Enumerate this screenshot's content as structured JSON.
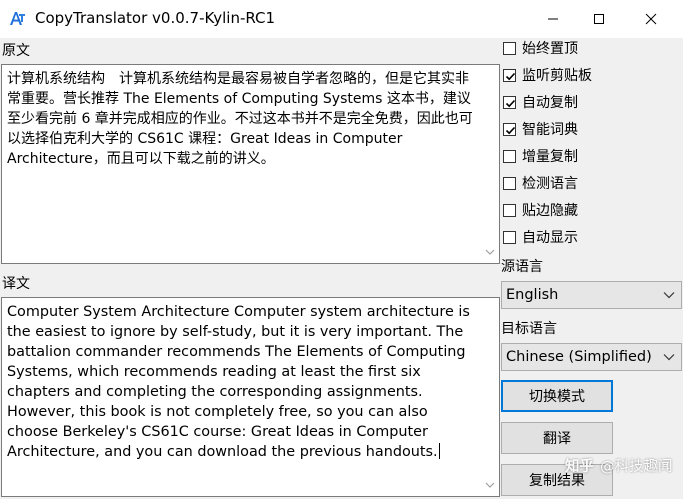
{
  "window": {
    "title": "CopyTranslator v0.0.7-Kylin-RC1",
    "icon": "copytranslator-logo-icon",
    "controls": [
      "minimize-icon",
      "maximize-icon",
      "close-icon"
    ]
  },
  "source": {
    "label": "原文",
    "text": "计算机系统结构　计算机系统结构是最容易被自学者忽略的，但是它其实非常重要。营长推荐 The Elements of Computing Systems 这本书，建议至少看完前 6 章并完成相应的作业。不过这本书并不是完全免费，因此也可以选择伯克利大学的 CS61C 课程：Great Ideas in Computer Architecture，而且可以下载之前的讲义。"
  },
  "target": {
    "label": "译文",
    "text": "Computer System Architecture Computer system architecture is the easiest to ignore by self-study, but it is very important. The battalion commander recommends The Elements of Computing Systems, which recommends reading at least the first six chapters and completing the corresponding assignments. However, this book is not completely free, so you can also choose Berkeley's CS61C course: Great Ideas in Computer Architecture, and you can download the previous handouts."
  },
  "options": [
    {
      "label": "始终置顶",
      "checked": false
    },
    {
      "label": "监听剪贴板",
      "checked": true
    },
    {
      "label": "自动复制",
      "checked": true
    },
    {
      "label": "智能词典",
      "checked": true
    },
    {
      "label": "增量复制",
      "checked": false
    },
    {
      "label": "检测语言",
      "checked": false
    },
    {
      "label": "贴边隐藏",
      "checked": false
    },
    {
      "label": "自动显示",
      "checked": false
    }
  ],
  "source_language": {
    "label": "源语言",
    "value": "English"
  },
  "target_language": {
    "label": "目标语言",
    "value": "Chinese (Simplified)"
  },
  "buttons": {
    "switch_mode": "切换模式",
    "translate": "翻译",
    "copy_result": "复制结果"
  },
  "watermark": {
    "logo": "知乎",
    "text": "@科技趣闻"
  },
  "colors": {
    "accent": "#0078d7",
    "logo_blue": "#1e6fd9",
    "check": "#000000"
  }
}
